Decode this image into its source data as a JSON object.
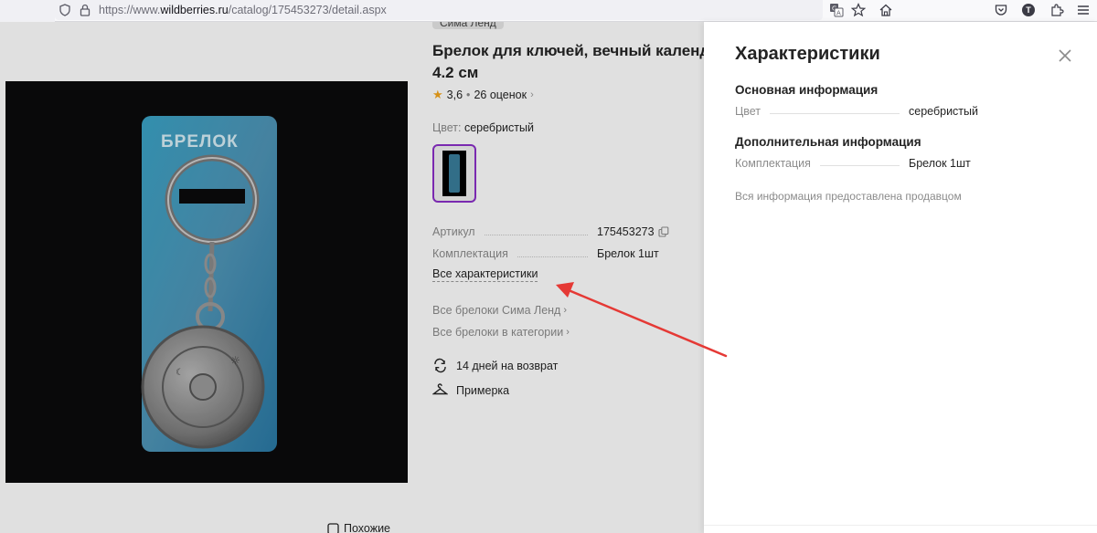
{
  "browser": {
    "url_prefix": "https://www.",
    "url_domain": "wildberries.ru",
    "url_path": "/catalog/175453273/detail.aspx",
    "profile_letter": "T"
  },
  "product": {
    "brand": "Сима Ленд",
    "title_line1": "Брелок для ключей, вечный календа",
    "title_line2": "4.2 см",
    "rating": "3,6",
    "reviews": "26 оценок",
    "color_label": "Цвет:",
    "color_value": "серебристый",
    "photo_caption": "БРЕЛОК",
    "specs": [
      {
        "key": "Артикул",
        "value": "175453273"
      },
      {
        "key": "Комплектация",
        "value": "Брелок 1шт"
      }
    ],
    "all_chars": "Все характеристики",
    "links": [
      "Все брелоки Сима Ленд",
      "Все брелоки в категории"
    ],
    "features": [
      "14 дней на возврат",
      "Примерка"
    ],
    "similar_button": "Похожие"
  },
  "panel": {
    "title": "Характеристики",
    "sections": [
      {
        "title": "Основная информация",
        "rows": [
          {
            "key": "Цвет",
            "value": "серебристый"
          }
        ]
      },
      {
        "title": "Дополнительная информация",
        "rows": [
          {
            "key": "Комплектация",
            "value": "Брелок 1шт"
          }
        ]
      }
    ],
    "note": "Вся информация предоставлена продавцом"
  },
  "colors": {
    "accent_purple": "#8b2fc9",
    "annotation_red": "#e53935",
    "star": "#f4a51c"
  }
}
